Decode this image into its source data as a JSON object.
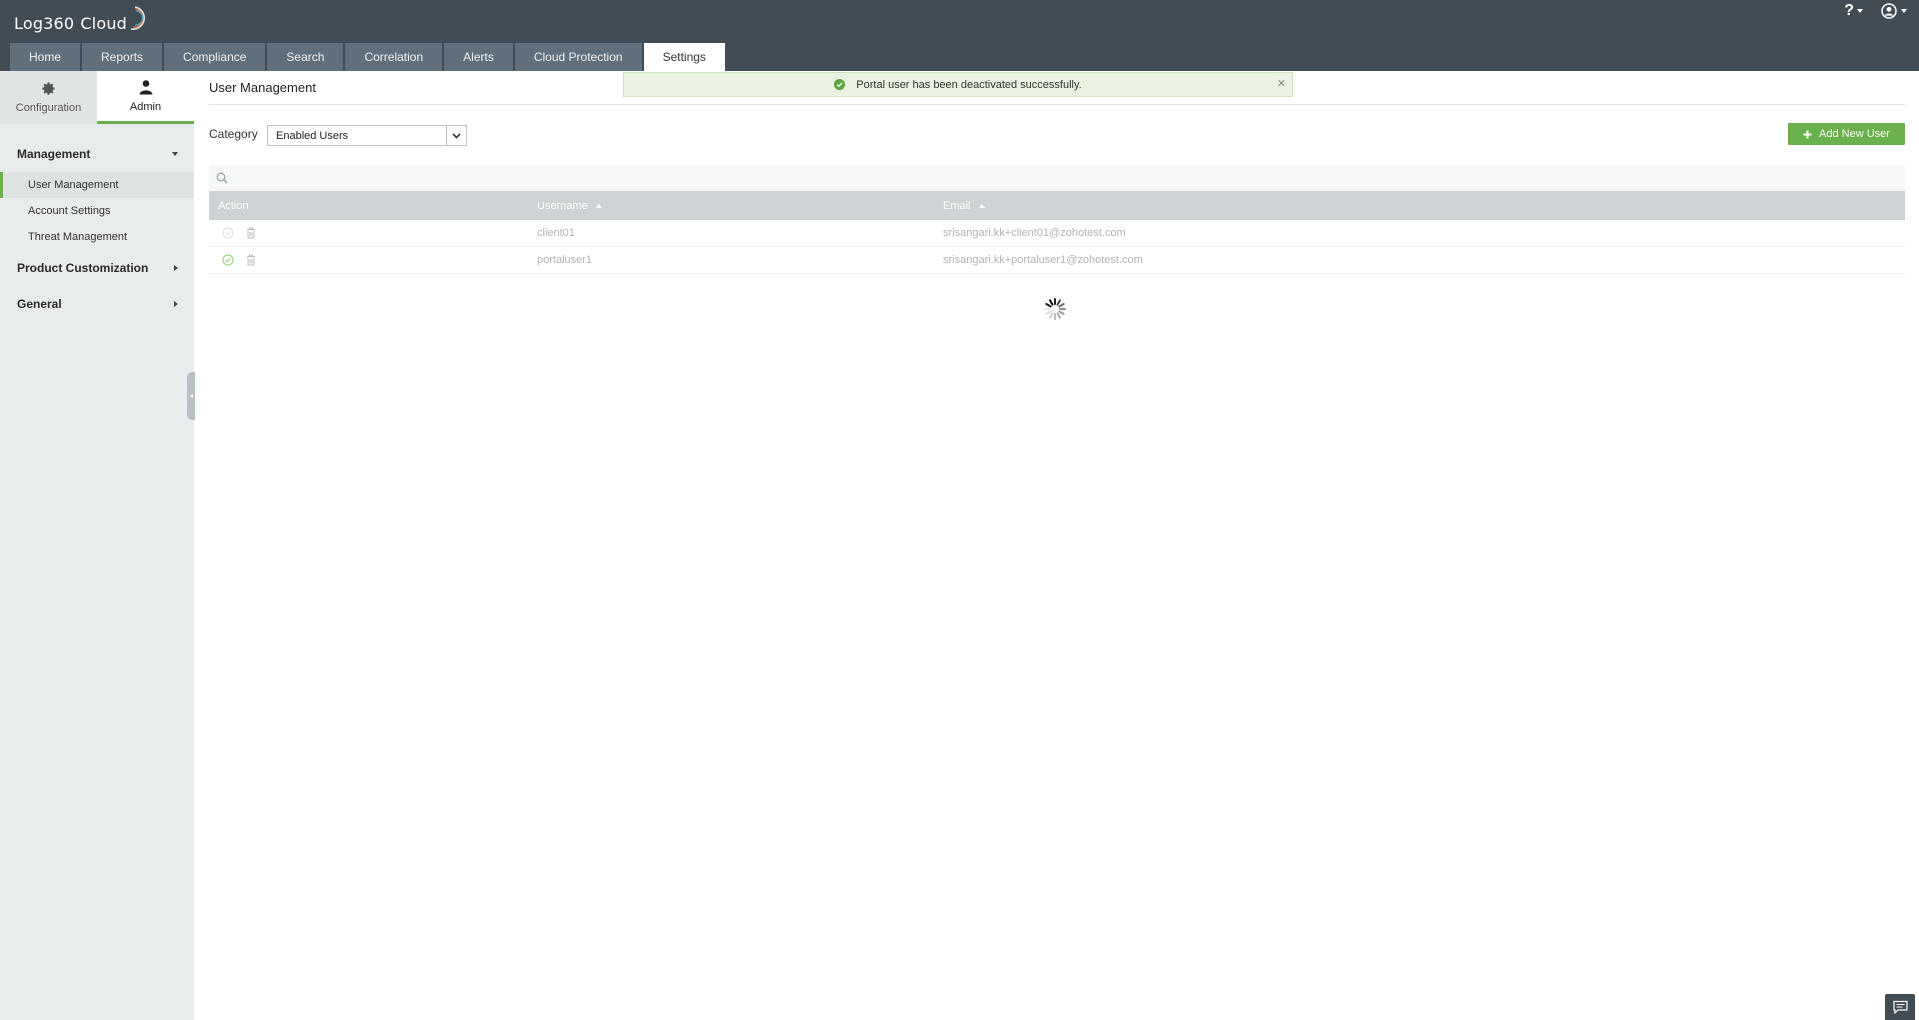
{
  "app": {
    "logo_text": "Log360",
    "logo_suffix": "Cloud"
  },
  "top_right": {
    "help_label": "?"
  },
  "tabs": [
    {
      "label": "Home"
    },
    {
      "label": "Reports"
    },
    {
      "label": "Compliance"
    },
    {
      "label": "Search"
    },
    {
      "label": "Correlation"
    },
    {
      "label": "Alerts"
    },
    {
      "label": "Cloud Protection"
    },
    {
      "label": "Settings",
      "active": true
    }
  ],
  "sidebar": {
    "switch": {
      "configuration": "Configuration",
      "admin": "Admin"
    },
    "sections": {
      "management": "Management",
      "product_customization": "Product Customization",
      "general": "General"
    },
    "management_items": [
      {
        "label": "User Management",
        "active": true
      },
      {
        "label": "Account Settings"
      },
      {
        "label": "Threat Management"
      }
    ]
  },
  "main": {
    "title": "User Management",
    "toast": "Portal user has been deactivated successfully.",
    "category_label": "Category",
    "category_value": "Enabled Users",
    "add_button": "Add New User",
    "table": {
      "headers": {
        "action": "Action",
        "username": "Username",
        "email": "Email"
      },
      "rows": [
        {
          "username": "client01",
          "email": "srisangari.kk+client01@zohotest.com"
        },
        {
          "username": "portaluser1",
          "email": "srisangari.kk+portaluser1@zohotest.com"
        }
      ]
    }
  },
  "colors": {
    "header_bg": "#414c55",
    "tab_bg": "#5f6f7c",
    "accent_green": "#6ab04c",
    "sidebar_bg": "#e9ecec",
    "table_head_bg": "#cdd2d4"
  }
}
